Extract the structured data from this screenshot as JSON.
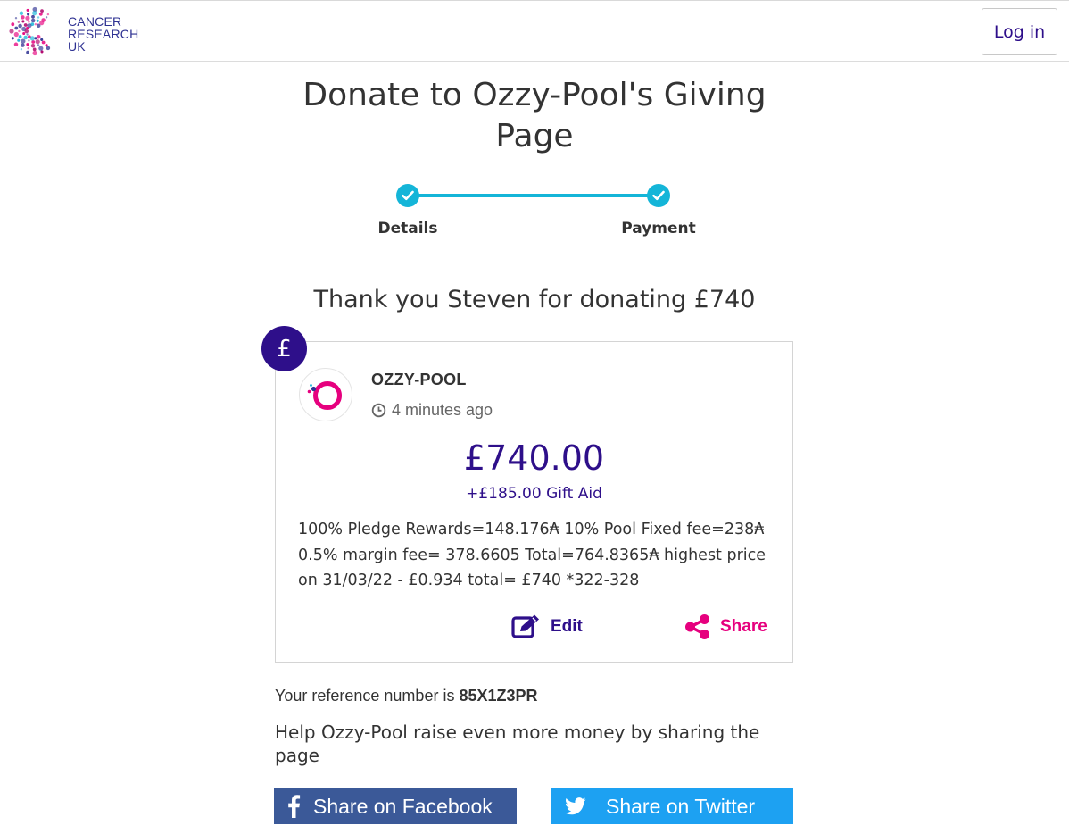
{
  "header": {
    "logo_lines": [
      "CANCER",
      "RESEARCH",
      "UK"
    ],
    "login_label": "Log in"
  },
  "page_title": "Donate to Ozzy-Pool's Giving Page",
  "stepper": {
    "steps": [
      {
        "label": "Details",
        "completed": true
      },
      {
        "label": "Payment",
        "completed": true
      }
    ],
    "accent_color": "#14b5d8"
  },
  "thanks_message": "Thank you Steven for donating £740",
  "donation_card": {
    "badge_symbol": "£",
    "donor_name": "OZZY-POOL",
    "time_ago": "4 minutes ago",
    "amount": "£740.00",
    "gift_aid": "+£185.00 Gift Aid",
    "message": "100% Pledge Rewards=148.176₳ 10% Pool Fixed fee=238₳ 0.5% margin fee= 378.6605 Total=764.8365₳ highest price on 31/03/22 - £0.934 total= £740 *322-328",
    "edit_label": "Edit",
    "share_label": "Share"
  },
  "reference": {
    "prefix": "Your reference number is",
    "number": "85X1Z3PR"
  },
  "help_text": "Help Ozzy-Pool raise even more money by sharing the page",
  "social": {
    "facebook_label": "Share on Facebook",
    "twitter_label": "Share on Twitter"
  },
  "colors": {
    "brand_purple": "#2e0f8a",
    "brand_pink": "#e6007e",
    "facebook": "#3b5998",
    "twitter": "#1da1f2"
  }
}
